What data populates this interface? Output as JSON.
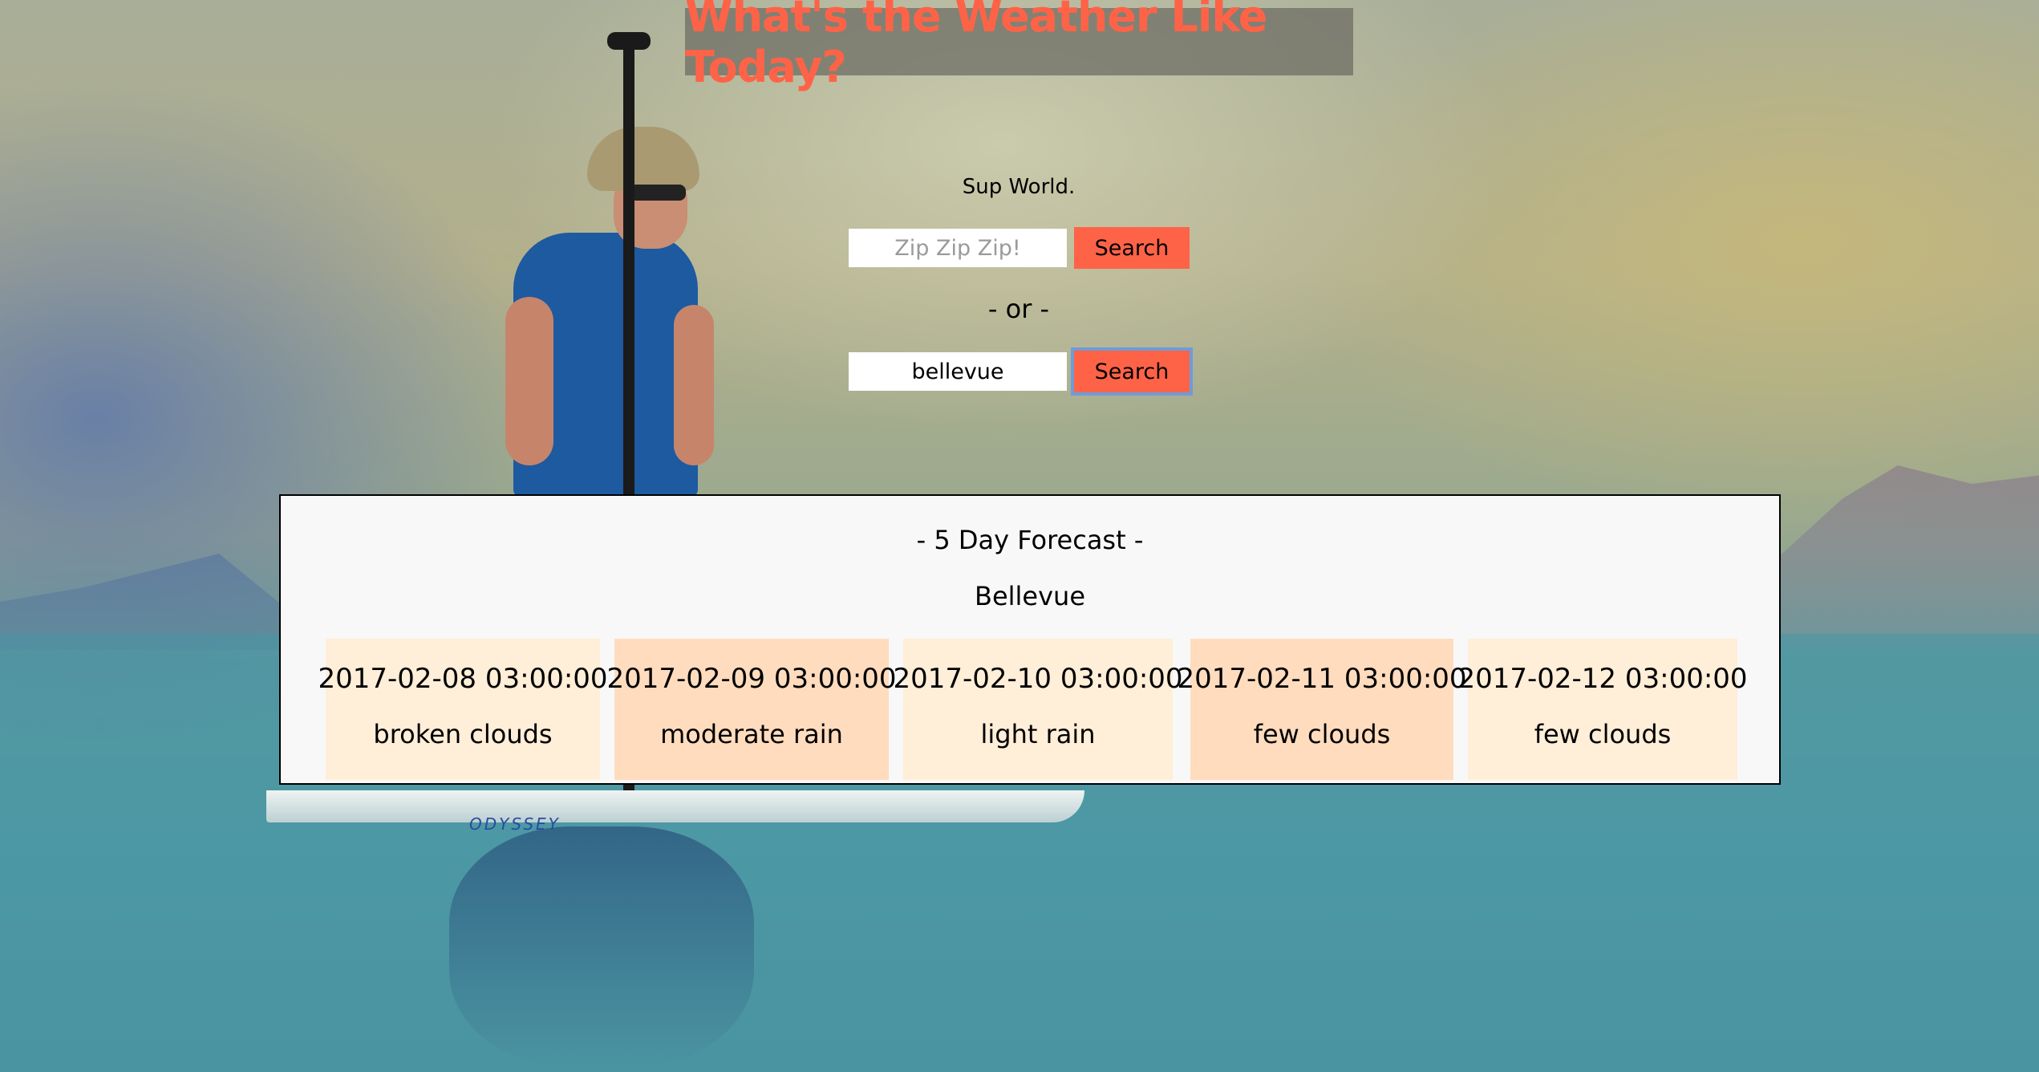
{
  "page": {
    "title": "What's the Weather Like Today?",
    "greeting": "Sup World."
  },
  "zip_search": {
    "placeholder": "Zip Zip Zip!",
    "value": "",
    "button_label": "Search"
  },
  "separator": "- or -",
  "city_search": {
    "placeholder": "",
    "value": "bellevue",
    "button_label": "Search"
  },
  "forecast": {
    "heading": "- 5 Day Forecast -",
    "city": "Bellevue",
    "days": [
      {
        "date": "2017-02-08 03:00:00",
        "description": "broken clouds"
      },
      {
        "date": "2017-02-09 03:00:00",
        "description": "moderate rain"
      },
      {
        "date": "2017-02-10 03:00:00",
        "description": "light rain"
      },
      {
        "date": "2017-02-11 03:00:00",
        "description": "few clouds"
      },
      {
        "date": "2017-02-12 03:00:00",
        "description": "few clouds"
      }
    ]
  },
  "colors": {
    "accent": "#ff6347",
    "card_light": "#ffeed8",
    "card_dark": "#ffdcbe",
    "panel": "#f8f8f8"
  },
  "background_image": {
    "board_brand": "ODYSSEY"
  }
}
